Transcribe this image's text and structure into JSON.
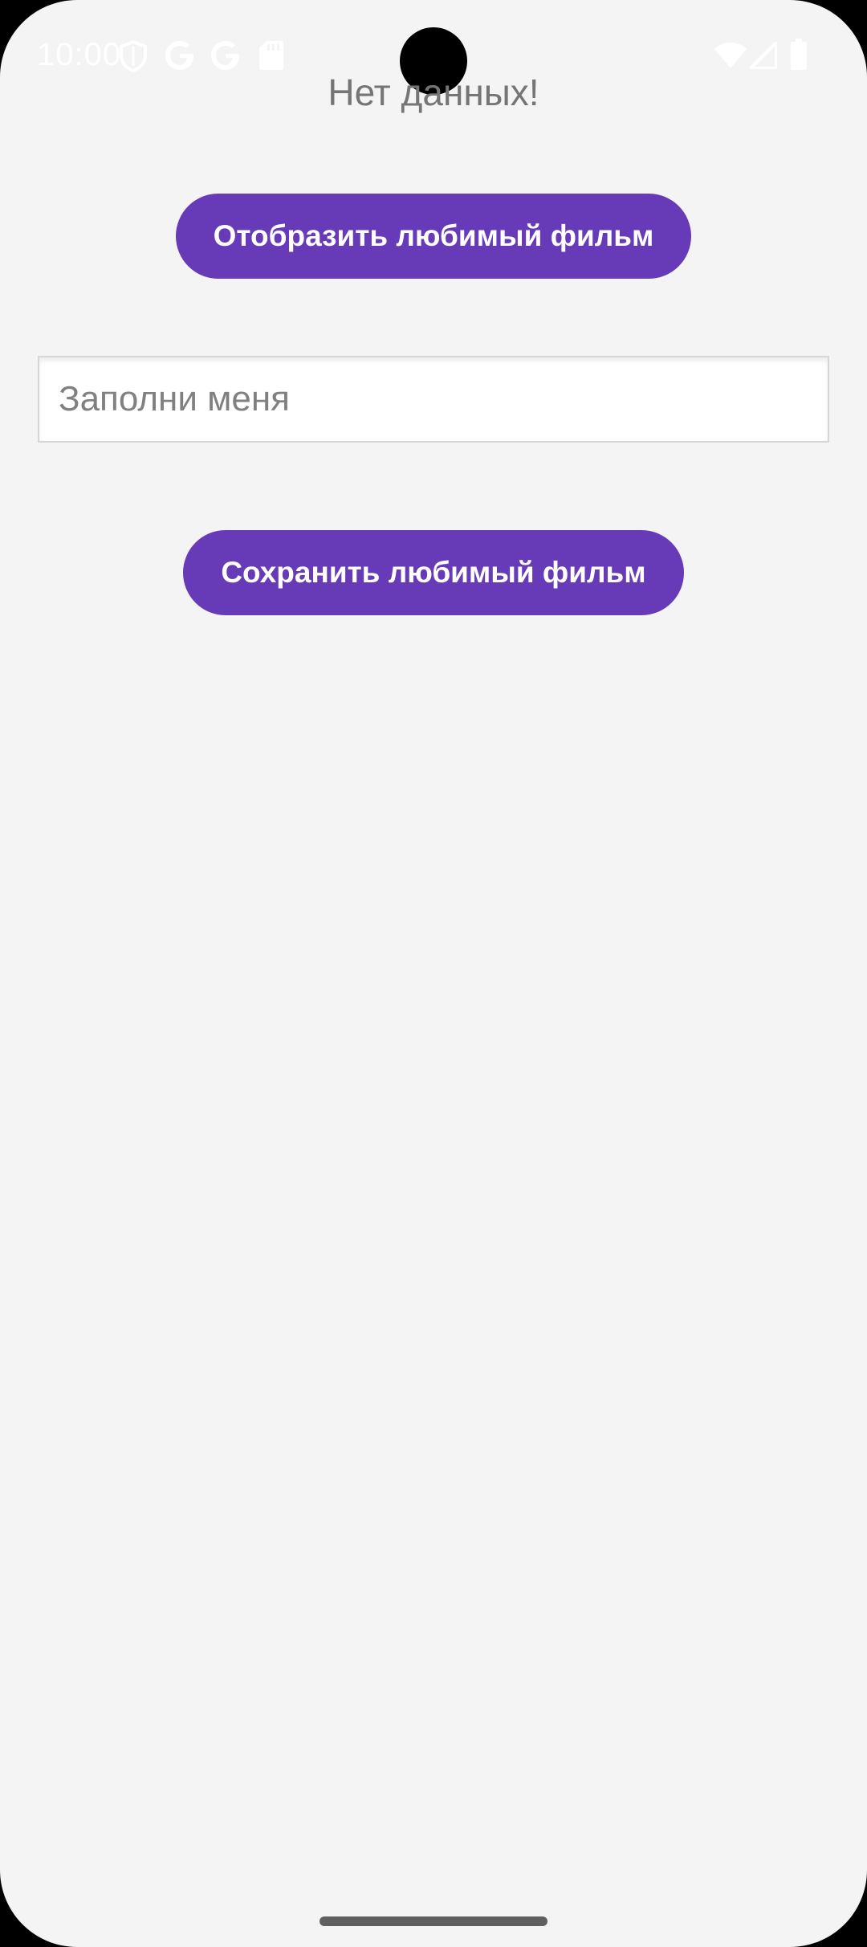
{
  "status_bar": {
    "time": "10:00",
    "icons": [
      "shield-icon",
      "google-icon",
      "google-icon",
      "sd-card-icon",
      "wifi-icon",
      "signal-icon",
      "battery-icon"
    ]
  },
  "main": {
    "empty_text": "Нет данных!",
    "show_button_label": "Отобразить любимый фильм",
    "movie_input": {
      "value": "",
      "placeholder": "Заполни меня"
    },
    "save_button_label": "Сохранить любимый фильм"
  },
  "colors": {
    "accent": "#673ab7",
    "background": "#f4f4f4",
    "status_text": "#ffffff"
  }
}
